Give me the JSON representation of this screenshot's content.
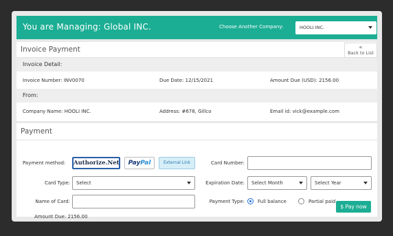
{
  "header": {
    "title": "You are Managing: Global INC.",
    "choose_label": "Choose Another Company:",
    "company_selected": "HOOLI INC."
  },
  "invoice": {
    "heading": "Invoice Payment",
    "back_icon": "«",
    "back_label": "Back to List",
    "detail_label": "Invoice Detail:",
    "number": "Invoice Number: INV0070",
    "due_date": "Due Date: 12/15/2021",
    "amount_due": "Amount Due (USD): 2156.00",
    "from_label": "From:",
    "company_name": "Company Name: HOOLI INC.",
    "address": "Address: #678, Gillco",
    "email": "Email id: vick@example.com"
  },
  "payment": {
    "heading": "Payment",
    "method_label": "Payment method:",
    "methods": {
      "authorize": "Authorize.Net",
      "paypal_a": "Pay",
      "paypal_b": "Pal",
      "external": "External Link"
    },
    "card_number_label": "Card Number:",
    "card_number_value": "",
    "card_type_label": "Card Type:",
    "card_type_value": "Select",
    "expiration_label": "Expiration Date:",
    "exp_month_value": "Select Month",
    "exp_year_value": "Select Year",
    "name_label": "Name of Card:",
    "name_value": "",
    "payment_type_label": "Payment Type:",
    "full_balance": "Full balance",
    "partial_paid": "Partial paid",
    "amount_due_text": "Amount Due: 2156.00",
    "pay_button_icon": "$",
    "pay_button": "Pay now"
  },
  "colors": {
    "accent": "#1cae94",
    "radio_selected": "#1e6fd9"
  }
}
